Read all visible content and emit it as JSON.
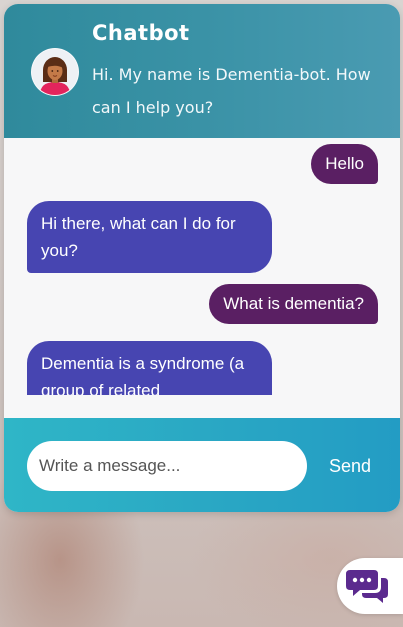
{
  "header": {
    "title": "Chatbot",
    "subtitle": "Hi. My name is Dementia-bot. How can I help you?"
  },
  "messages": [
    {
      "sender": "user",
      "text": "Hello"
    },
    {
      "sender": "bot",
      "text": "Hi there, what can I do for you?"
    },
    {
      "sender": "user",
      "text": "What is dementia?"
    },
    {
      "sender": "bot",
      "text": "Dementia is a syndrome (a group of related"
    }
  ],
  "composer": {
    "placeholder": "Write a message...",
    "send_label": "Send"
  },
  "colors": {
    "header": "#3a92a6",
    "user_bubble": "#5a1f63",
    "bot_bubble": "#4745b1",
    "composer": "#2aa8c4",
    "launcher_icon": "#5b2a8e"
  },
  "icons": {
    "avatar": "woman-avatar",
    "launcher": "chat-bubbles-icon"
  }
}
